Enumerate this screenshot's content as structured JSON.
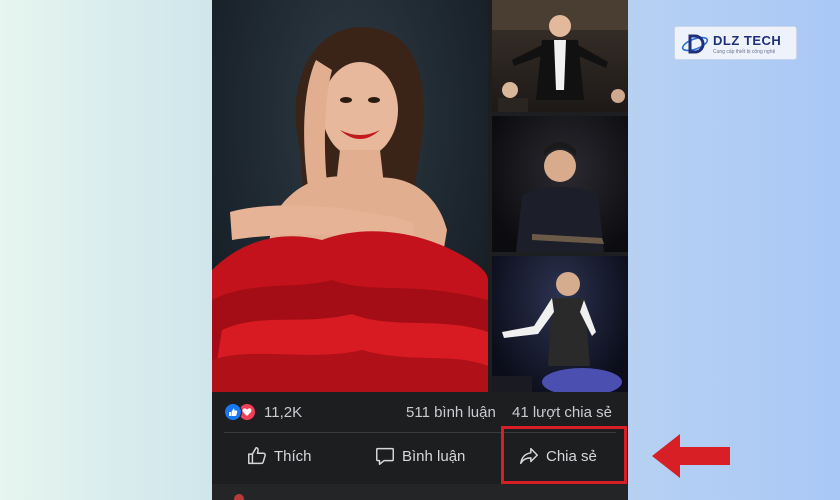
{
  "post": {
    "stats": {
      "reaction_count": "11,2K",
      "comments": "511 bình luận",
      "shares": "41 lượt chia sẻ"
    },
    "actions": {
      "like": "Thích",
      "comment": "Bình luận",
      "share": "Chia sẻ"
    }
  },
  "logo": {
    "name": "DLZ TECH",
    "tagline": "Cung cấp thiết bị công nghệ"
  },
  "colors": {
    "highlight": "#d81f26",
    "like_blue": "#1877f2",
    "love_red": "#f33e58",
    "panel_bg": "#1d1e20"
  },
  "icons": [
    "like-reaction-icon",
    "love-reaction-icon",
    "thumbs-up-icon",
    "comment-bubble-icon",
    "share-arrow-icon",
    "pointer-arrow-icon"
  ]
}
